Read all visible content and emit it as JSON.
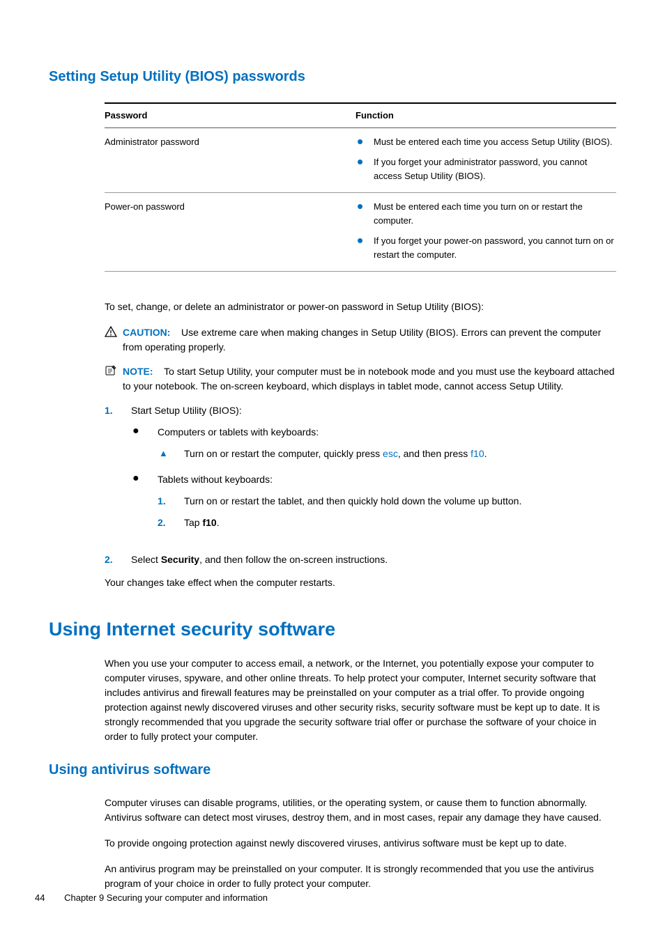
{
  "h2_bios": "Setting Setup Utility (BIOS) passwords",
  "table": {
    "head": {
      "c1": "Password",
      "c2": "Function"
    },
    "rows": [
      {
        "c1": "Administrator password",
        "bullets": [
          "Must be entered each time you access Setup Utility (BIOS).",
          "If you forget your administrator password, you cannot access Setup Utility (BIOS)."
        ]
      },
      {
        "c1": "Power-on password",
        "bullets": [
          "Must be entered each time you turn on or restart the computer.",
          "If you forget your power-on password, you cannot turn on or restart the computer."
        ]
      }
    ]
  },
  "para_intro": "To set, change, or delete an administrator or power-on password in Setup Utility (BIOS):",
  "caution": {
    "label": "CAUTION:",
    "text": "Use extreme care when making changes in Setup Utility (BIOS). Errors can prevent the computer from operating properly."
  },
  "note": {
    "label": "NOTE:",
    "text": "To start Setup Utility, your computer must be in notebook mode and you must use the keyboard attached to your notebook. The on-screen keyboard, which displays in tablet mode, cannot access Setup Utility."
  },
  "steps": {
    "s1": {
      "n": "1.",
      "text": "Start Setup Utility (BIOS):",
      "sub_a_label": "Computers or tablets with keyboards:",
      "sub_a_tri_pre": "Turn on or restart the computer, quickly press ",
      "sub_a_tri_k1": "esc",
      "sub_a_tri_mid": ", and then press ",
      "sub_a_tri_k2": "f10",
      "sub_a_tri_post": ".",
      "sub_b_label": "Tablets without keyboards:",
      "sub_b_1_n": "1.",
      "sub_b_1_t": "Turn on or restart the tablet, and then quickly hold down the volume up button.",
      "sub_b_2_n": "2.",
      "sub_b_2_pre": "Tap ",
      "sub_b_2_b": "f10",
      "sub_b_2_post": "."
    },
    "s2": {
      "n": "2.",
      "pre": "Select ",
      "b": "Security",
      "post": ", and then follow the on-screen instructions."
    }
  },
  "para_effect": "Your changes take effect when the computer restarts.",
  "h1_internet": "Using Internet security software",
  "para_internet": "When you use your computer to access email, a network, or the Internet, you potentially expose your computer to computer viruses, spyware, and other online threats. To help protect your computer, Internet security software that includes antivirus and firewall features may be preinstalled on your computer as a trial offer. To provide ongoing protection against newly discovered viruses and other security risks, security software must be kept up to date. It is strongly recommended that you upgrade the security software trial offer or purchase the software of your choice in order to fully protect your computer.",
  "h2_antivirus": "Using antivirus software",
  "para_av1": "Computer viruses can disable programs, utilities, or the operating system, or cause them to function abnormally. Antivirus software can detect most viruses, destroy them, and in most cases, repair any damage they have caused.",
  "para_av2": "To provide ongoing protection against newly discovered viruses, antivirus software must be kept up to date.",
  "para_av3": "An antivirus program may be preinstalled on your computer. It is strongly recommended that you use the antivirus program of your choice in order to fully protect your computer.",
  "footer": {
    "page": "44",
    "chapter": "Chapter 9   Securing your computer and information"
  }
}
